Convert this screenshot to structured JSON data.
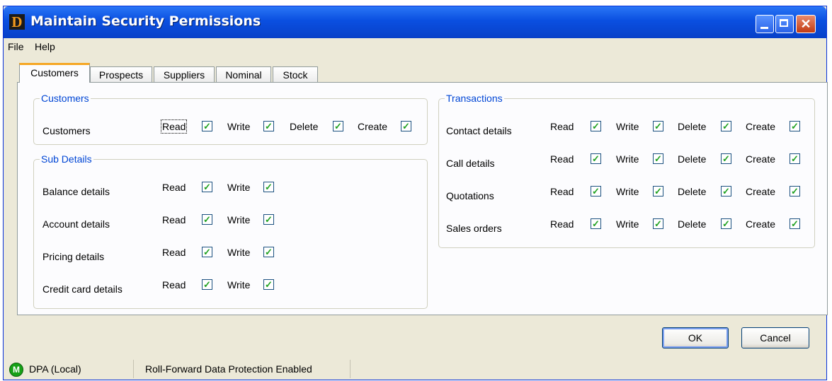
{
  "window": {
    "title": "Maintain Security Permissions"
  },
  "menu": {
    "file": "File",
    "help": "Help"
  },
  "tabs": [
    "Customers",
    "Prospects",
    "Suppliers",
    "Nominal",
    "Stock"
  ],
  "perm_labels": {
    "read": "Read",
    "write": "Write",
    "delete": "Delete",
    "create": "Create"
  },
  "customers_group": {
    "legend": "Customers",
    "rows": [
      {
        "label": "Customers",
        "read": true,
        "write": true,
        "delete": true,
        "create": true
      }
    ]
  },
  "sub_details_group": {
    "legend": "Sub Details",
    "rows": [
      {
        "label": "Balance details",
        "read": true,
        "write": true
      },
      {
        "label": "Account details",
        "read": true,
        "write": true
      },
      {
        "label": "Pricing details",
        "read": true,
        "write": true
      },
      {
        "label": "Credit card details",
        "read": true,
        "write": true
      }
    ]
  },
  "transactions_group": {
    "legend": "Transactions",
    "rows": [
      {
        "label": "Contact details",
        "read": true,
        "write": true,
        "delete": true,
        "create": true
      },
      {
        "label": "Call details",
        "read": true,
        "write": true,
        "delete": true,
        "create": true
      },
      {
        "label": "Quotations",
        "read": true,
        "write": true,
        "delete": true,
        "create": true
      },
      {
        "label": "Sales orders",
        "read": true,
        "write": true,
        "delete": true,
        "create": true
      }
    ]
  },
  "buttons": {
    "ok": "OK",
    "cancel": "Cancel"
  },
  "statusbar": {
    "icon_letter": "M",
    "connection": "DPA (Local)",
    "protection": "Roll-Forward Data Protection Enabled"
  },
  "icons": {
    "app": "D",
    "check": "✓",
    "close": "✕"
  },
  "colors": {
    "title_bar": "#0a4fe0",
    "legend_text": "#0046d5",
    "checkmark": "#21a121",
    "status_icon": "#17a117"
  }
}
